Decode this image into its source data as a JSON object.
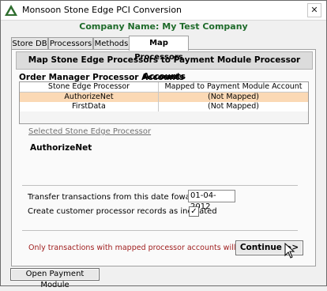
{
  "window": {
    "title": "Monsoon Stone Edge PCI Conversion",
    "close_label": "✕"
  },
  "company": {
    "label": "Company Name: My Test Company"
  },
  "tabs": [
    {
      "label": "Store DB"
    },
    {
      "label": "Processors"
    },
    {
      "label": "Methods"
    },
    {
      "label": "Map Processors"
    }
  ],
  "banner": "Map Stone Edge Processors to Payment Module Processor Accounts",
  "grid": {
    "title": "Order Manager Processor Accounts",
    "columns": [
      "Stone Edge Processor",
      "Mapped to Payment Module Account"
    ],
    "rows": [
      [
        "AuthorizeNet",
        "(Not Mapped)"
      ],
      [
        "FirstData",
        "(Not Mapped)"
      ]
    ]
  },
  "selected": {
    "label": "Selected Stone Edge Processor",
    "value": "AuthorizeNet"
  },
  "transfer": {
    "label": "Transfer transactions from this date foward:",
    "value": "01-04-2012"
  },
  "create_records": {
    "label": "Create customer processor records as indicated",
    "mark": "✓"
  },
  "note": "Only transactions with mapped processor accounts will be converted",
  "buttons": {
    "continue": "Continue >>",
    "open_payment": "Open Payment Module"
  }
}
